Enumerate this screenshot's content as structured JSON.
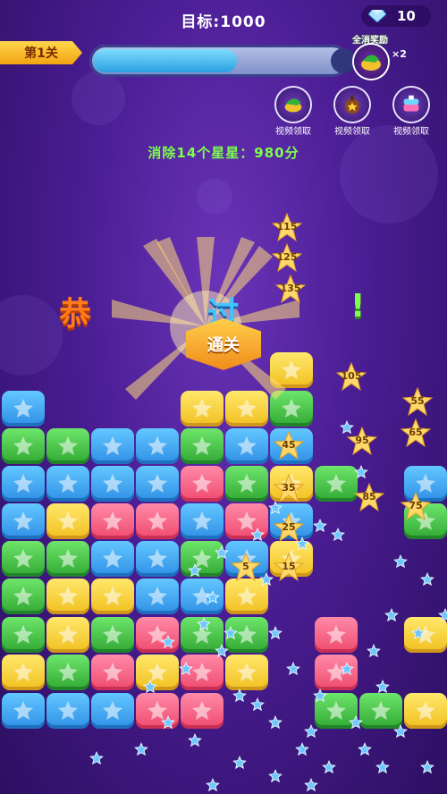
{
  "header": {
    "target_text": "目标:1000",
    "gems": "10"
  },
  "level": {
    "label": "第1关",
    "progress_fraction": 0.57
  },
  "bonus": {
    "label": "全消奖励",
    "multiplier": "×2"
  },
  "tools": [
    {
      "name": "tool-hammer",
      "label": "视频领取"
    },
    {
      "name": "tool-bomb",
      "label": "视频领取"
    },
    {
      "name": "tool-brush",
      "label": "视频领取"
    }
  ],
  "score_line": "消除14个星星：980分",
  "celebration": {
    "left_char": "恭",
    "middle_char": "过",
    "exclaim": "!",
    "badge_text": "通关"
  },
  "popup_scores": [
    "115",
    "125",
    "135",
    "105",
    "55",
    "95",
    "65",
    "45",
    "85",
    "35",
    "75",
    "25",
    "5",
    "15"
  ],
  "colors": {
    "blue": "#2f8fe6",
    "green": "#30a832",
    "yellow": "#f1bf1f",
    "red": "#ef4a6f",
    "score_green": "#7dff4a"
  }
}
